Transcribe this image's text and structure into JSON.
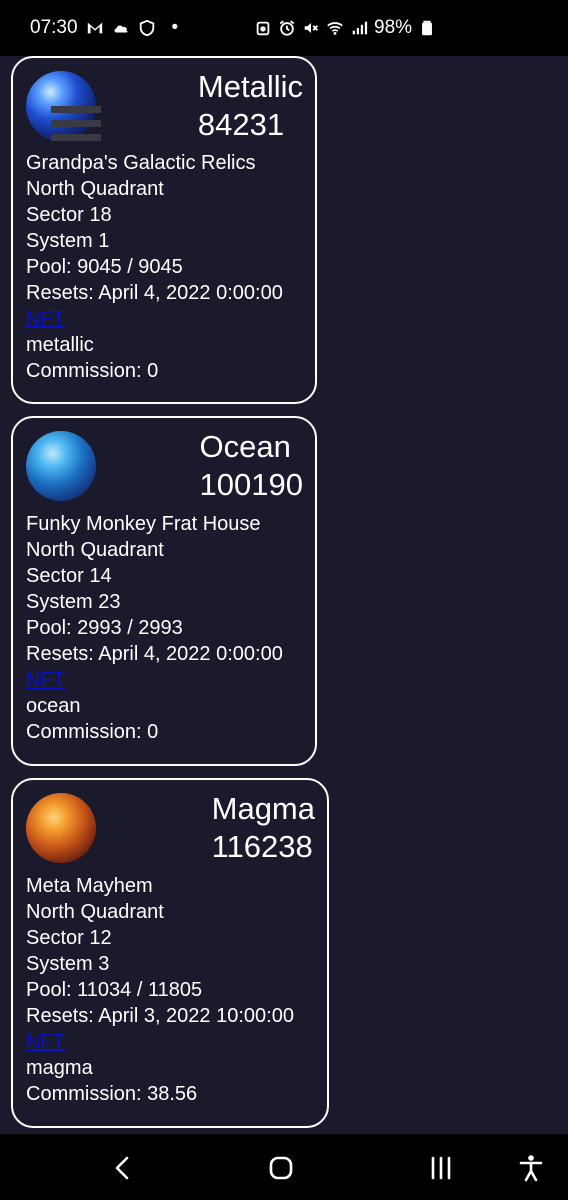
{
  "status_bar": {
    "time": "07:30",
    "battery": "98%",
    "dot": "•"
  },
  "cards": [
    {
      "name": "Metallic",
      "id": "84231",
      "owner": "Grandpa's Galactic Relics",
      "quadrant": "North Quadrant",
      "sector": "Sector 18",
      "system": "System 1",
      "pool": "Pool: 9045 / 9045",
      "resets": "Resets: April 4, 2022 0:00:00",
      "nft_label": "NFT",
      "type": "metallic",
      "commission": "Commission: 0"
    },
    {
      "name": "Ocean",
      "id": "100190",
      "owner": "Funky Monkey Frat House",
      "quadrant": "North Quadrant",
      "sector": "Sector 14",
      "system": "System 23",
      "pool": "Pool: 2993 / 2993",
      "resets": "Resets: April 4, 2022 0:00:00",
      "nft_label": "NFT",
      "type": "ocean",
      "commission": "Commission: 0"
    },
    {
      "name": "Magma",
      "id": "116238",
      "owner": "Meta Mayhem",
      "quadrant": "North Quadrant",
      "sector": "Sector 12",
      "system": "System 3",
      "pool": "Pool: 11034 / 11805",
      "resets": "Resets: April 3, 2022 10:00:00",
      "nft_label": "NFT",
      "type": "magma",
      "commission": "Commission: 38.56"
    }
  ],
  "colors": {
    "background": "#1a1a2c",
    "card_border": "#ffffff",
    "link": "#0a12c8",
    "bars": "#000000"
  },
  "icons": {
    "status": [
      "gmail-icon",
      "cloud-icon",
      "shield-icon",
      "recycle-icon",
      "alarm-icon",
      "mute-icon",
      "wifi-icon",
      "signal-icon",
      "battery-icon"
    ],
    "nav": [
      "back-icon",
      "home-icon",
      "recents-icon",
      "accessibility-icon"
    ]
  }
}
